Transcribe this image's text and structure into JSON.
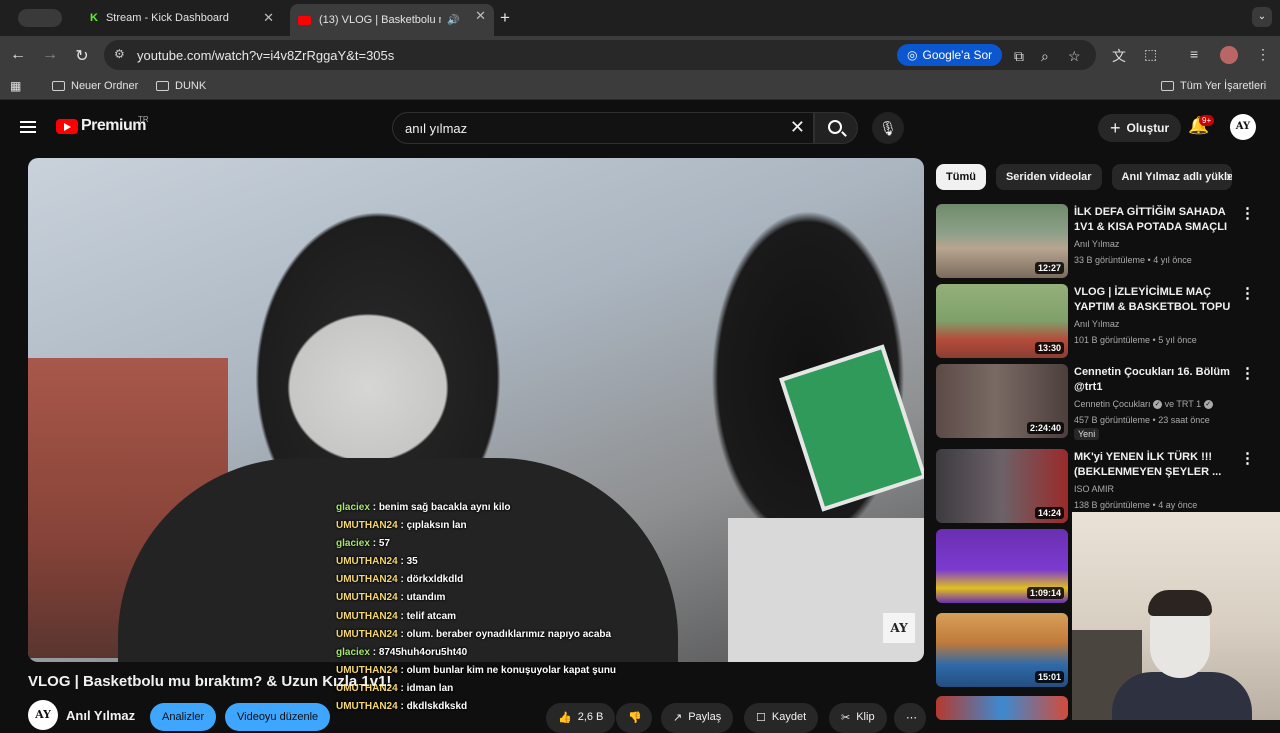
{
  "browser": {
    "tabs": [
      {
        "title": "Stream - Kick Dashboard"
      },
      {
        "title": "(13) VLOG | Basketbolu m"
      }
    ],
    "url": "youtube.com/watch?v=i4v8ZrRggaY&t=305s",
    "ask_google": "Google'a Sor",
    "bookmarks": [
      "Neuer Ordner",
      "DUNK"
    ],
    "all_bookmarks": "Tüm Yer İşaretleri"
  },
  "youtube": {
    "logo_text": "Premium",
    "logo_region": "TR",
    "search_query": "anıl yılmaz",
    "create_label": "Oluştur",
    "notif_badge": "9+",
    "avatar_text": "AY"
  },
  "video": {
    "title": "VLOG | Basketbolu mu bıraktım? & Uzun Kızla 1v1!",
    "channel": "Anıl Yılmaz",
    "analytics_label": "Analizler",
    "edit_label": "Videoyu düzenle",
    "likes": "2,6 B",
    "share_label": "Paylaş",
    "save_label": "Kaydet",
    "clip_label": "Klip",
    "watermark": "AY"
  },
  "chat": [
    {
      "user": "glaciex",
      "msg": "benim sağ bacakla aynı kilo"
    },
    {
      "user": "UMUTHAN24",
      "msg": "çıplaksın lan"
    },
    {
      "user": "glaciex",
      "msg": "57"
    },
    {
      "user": "UMUTHAN24",
      "msg": "35"
    },
    {
      "user": "UMUTHAN24",
      "msg": "dörkxldkdld"
    },
    {
      "user": "UMUTHAN24",
      "msg": "utandım"
    },
    {
      "user": "UMUTHAN24",
      "msg": "telif atcam"
    },
    {
      "user": "UMUTHAN24",
      "msg": "olum. beraber oynadıklarımız napıyo acaba"
    },
    {
      "user": "glaciex",
      "msg": "8745huh4oru5ht40"
    },
    {
      "user": "UMUTHAN24",
      "msg": "olum bunlar kim ne konuşuyolar kapat şunu"
    },
    {
      "user": "UMUTHAN24",
      "msg": "idman lan"
    },
    {
      "user": "UMUTHAN24",
      "msg": "dkdlskdkskd"
    }
  ],
  "chips": [
    "Tümü",
    "Seriden videolar",
    "Anıl Yılmaz adlı yükle"
  ],
  "recs": [
    {
      "title": "İLK DEFA GİTTİĞİM SAHADA 1V1 & KISA POTADA SMAÇLI ...",
      "channel": "Anıl Yılmaz",
      "meta": "33 B görüntüleme • 4 yıl önce",
      "duration": "12:27"
    },
    {
      "title": "VLOG | İZLEYİCİMLE MAÇ YAPTIM & BASKETBOL TOPU ...",
      "channel": "Anıl Yılmaz",
      "meta": "101 B görüntüleme • 5 yıl önce",
      "duration": "13:30"
    },
    {
      "title": "Cennetin Çocukları 16. Bölüm @trt1",
      "channel": "Cennetin Çocukları",
      "channel2": "ve TRT 1",
      "meta": "457 B görüntüleme • 23 saat önce",
      "badge": "Yeni",
      "duration": "2:24:40"
    },
    {
      "title": "MK'yi YENEN İLK TÜRK !!! (BEKLENMEYEN ŞEYLER ...",
      "channel": "ISO AMIR",
      "meta": "138 B görüntüleme • 4 ay önce",
      "duration": "14:24"
    },
    {
      "title": "",
      "duration": "1:09:14"
    },
    {
      "title": "",
      "duration": "15:01"
    }
  ],
  "colors": {
    "accent_blue": "#3ea6ff",
    "yt_red": "#ff0000",
    "chat_user_green": "#a6e66e",
    "chat_user_yellow": "#f5d76e"
  }
}
